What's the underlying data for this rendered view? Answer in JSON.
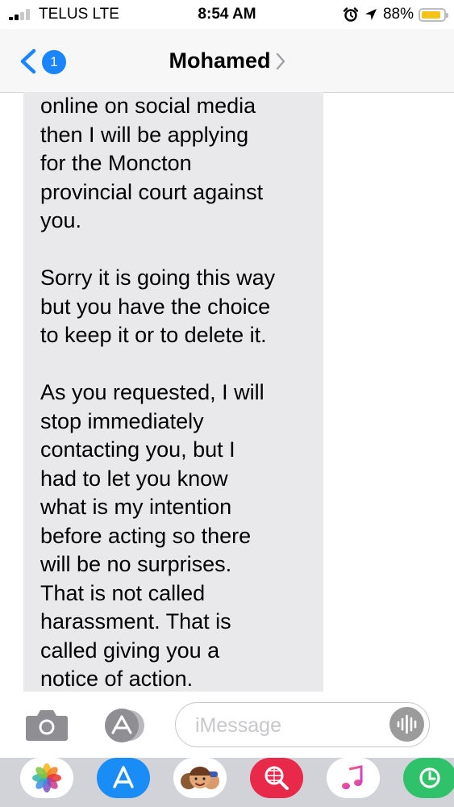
{
  "status_bar": {
    "carrier": "TELUS LTE",
    "time": "8:54 AM",
    "battery_percent": "88%",
    "battery_level": 0.88,
    "icons": [
      "signal-icon",
      "alarm-icon",
      "location-arrow-icon",
      "battery-icon"
    ]
  },
  "nav": {
    "back_badge": "1",
    "contact_name": "Mohamed",
    "icons": [
      "chevron-left-icon",
      "chevron-right-icon"
    ]
  },
  "message": {
    "text": "online on social media\nthen I will be applying\nfor the Moncton\nprovincial court against\nyou.\n\nSorry it is going this way\nbut you have the choice\nto keep it or to delete it.\n\nAs you requested, I will\nstop immediately\ncontacting you, but I\nhad to let you know\nwhat is my intention\nbefore acting so there\nwill be no surprises.\nThat is not called\nharassment. That is\ncalled giving you a\nnotice of action."
  },
  "input_bar": {
    "placeholder": "iMessage",
    "icons": [
      "camera-icon",
      "app-store-icon",
      "audio-waveform-icon"
    ]
  },
  "app_drawer": {
    "apps": [
      "photos-icon",
      "app-store-icon",
      "memoji-icon",
      "web-search-icon",
      "music-icon",
      "activity-icon"
    ]
  },
  "colors": {
    "accent": "#1b84ff",
    "bubble": "#e9e9eb",
    "battery": "#f3c31a",
    "drawer": "#d2d3d8"
  }
}
